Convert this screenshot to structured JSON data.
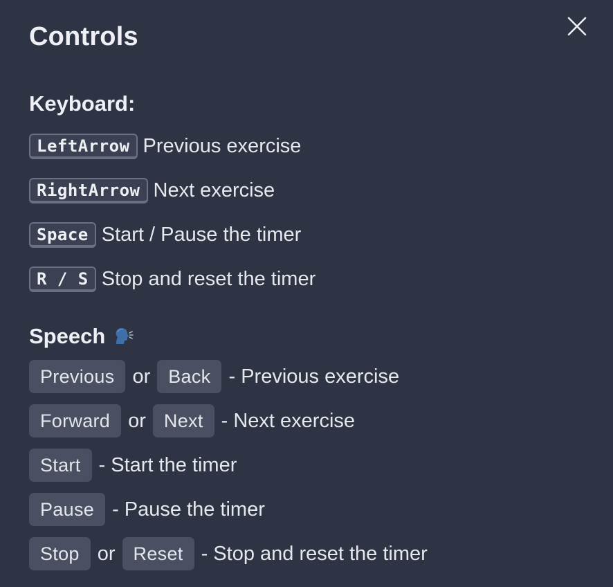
{
  "title": "Controls",
  "close_icon": "close-icon",
  "keyboard": {
    "heading": "Keyboard:",
    "items": [
      {
        "key": "LeftArrow",
        "desc": "Previous exercise"
      },
      {
        "key": "RightArrow",
        "desc": "Next exercise"
      },
      {
        "key": "Space",
        "desc": "Start / Pause the timer"
      },
      {
        "key": "R / S",
        "desc": "Stop and reset the timer"
      }
    ]
  },
  "speech": {
    "heading": "Speech",
    "heading_icon": "speaking-head-icon",
    "or_label": "or",
    "items": [
      {
        "cmd1": "Previous",
        "cmd2": "Back",
        "desc": "- Previous exercise"
      },
      {
        "cmd1": "Forward",
        "cmd2": "Next",
        "desc": "- Next exercise"
      },
      {
        "cmd1": "Start",
        "desc": "- Start the timer"
      },
      {
        "cmd1": "Pause",
        "desc": "- Pause the timer"
      },
      {
        "cmd1": "Stop",
        "cmd2": "Reset",
        "desc": "- Stop and reset the timer"
      }
    ]
  },
  "colors": {
    "background": "#2f3444",
    "chip": "#4a5061",
    "text": "#e6e8ee"
  }
}
